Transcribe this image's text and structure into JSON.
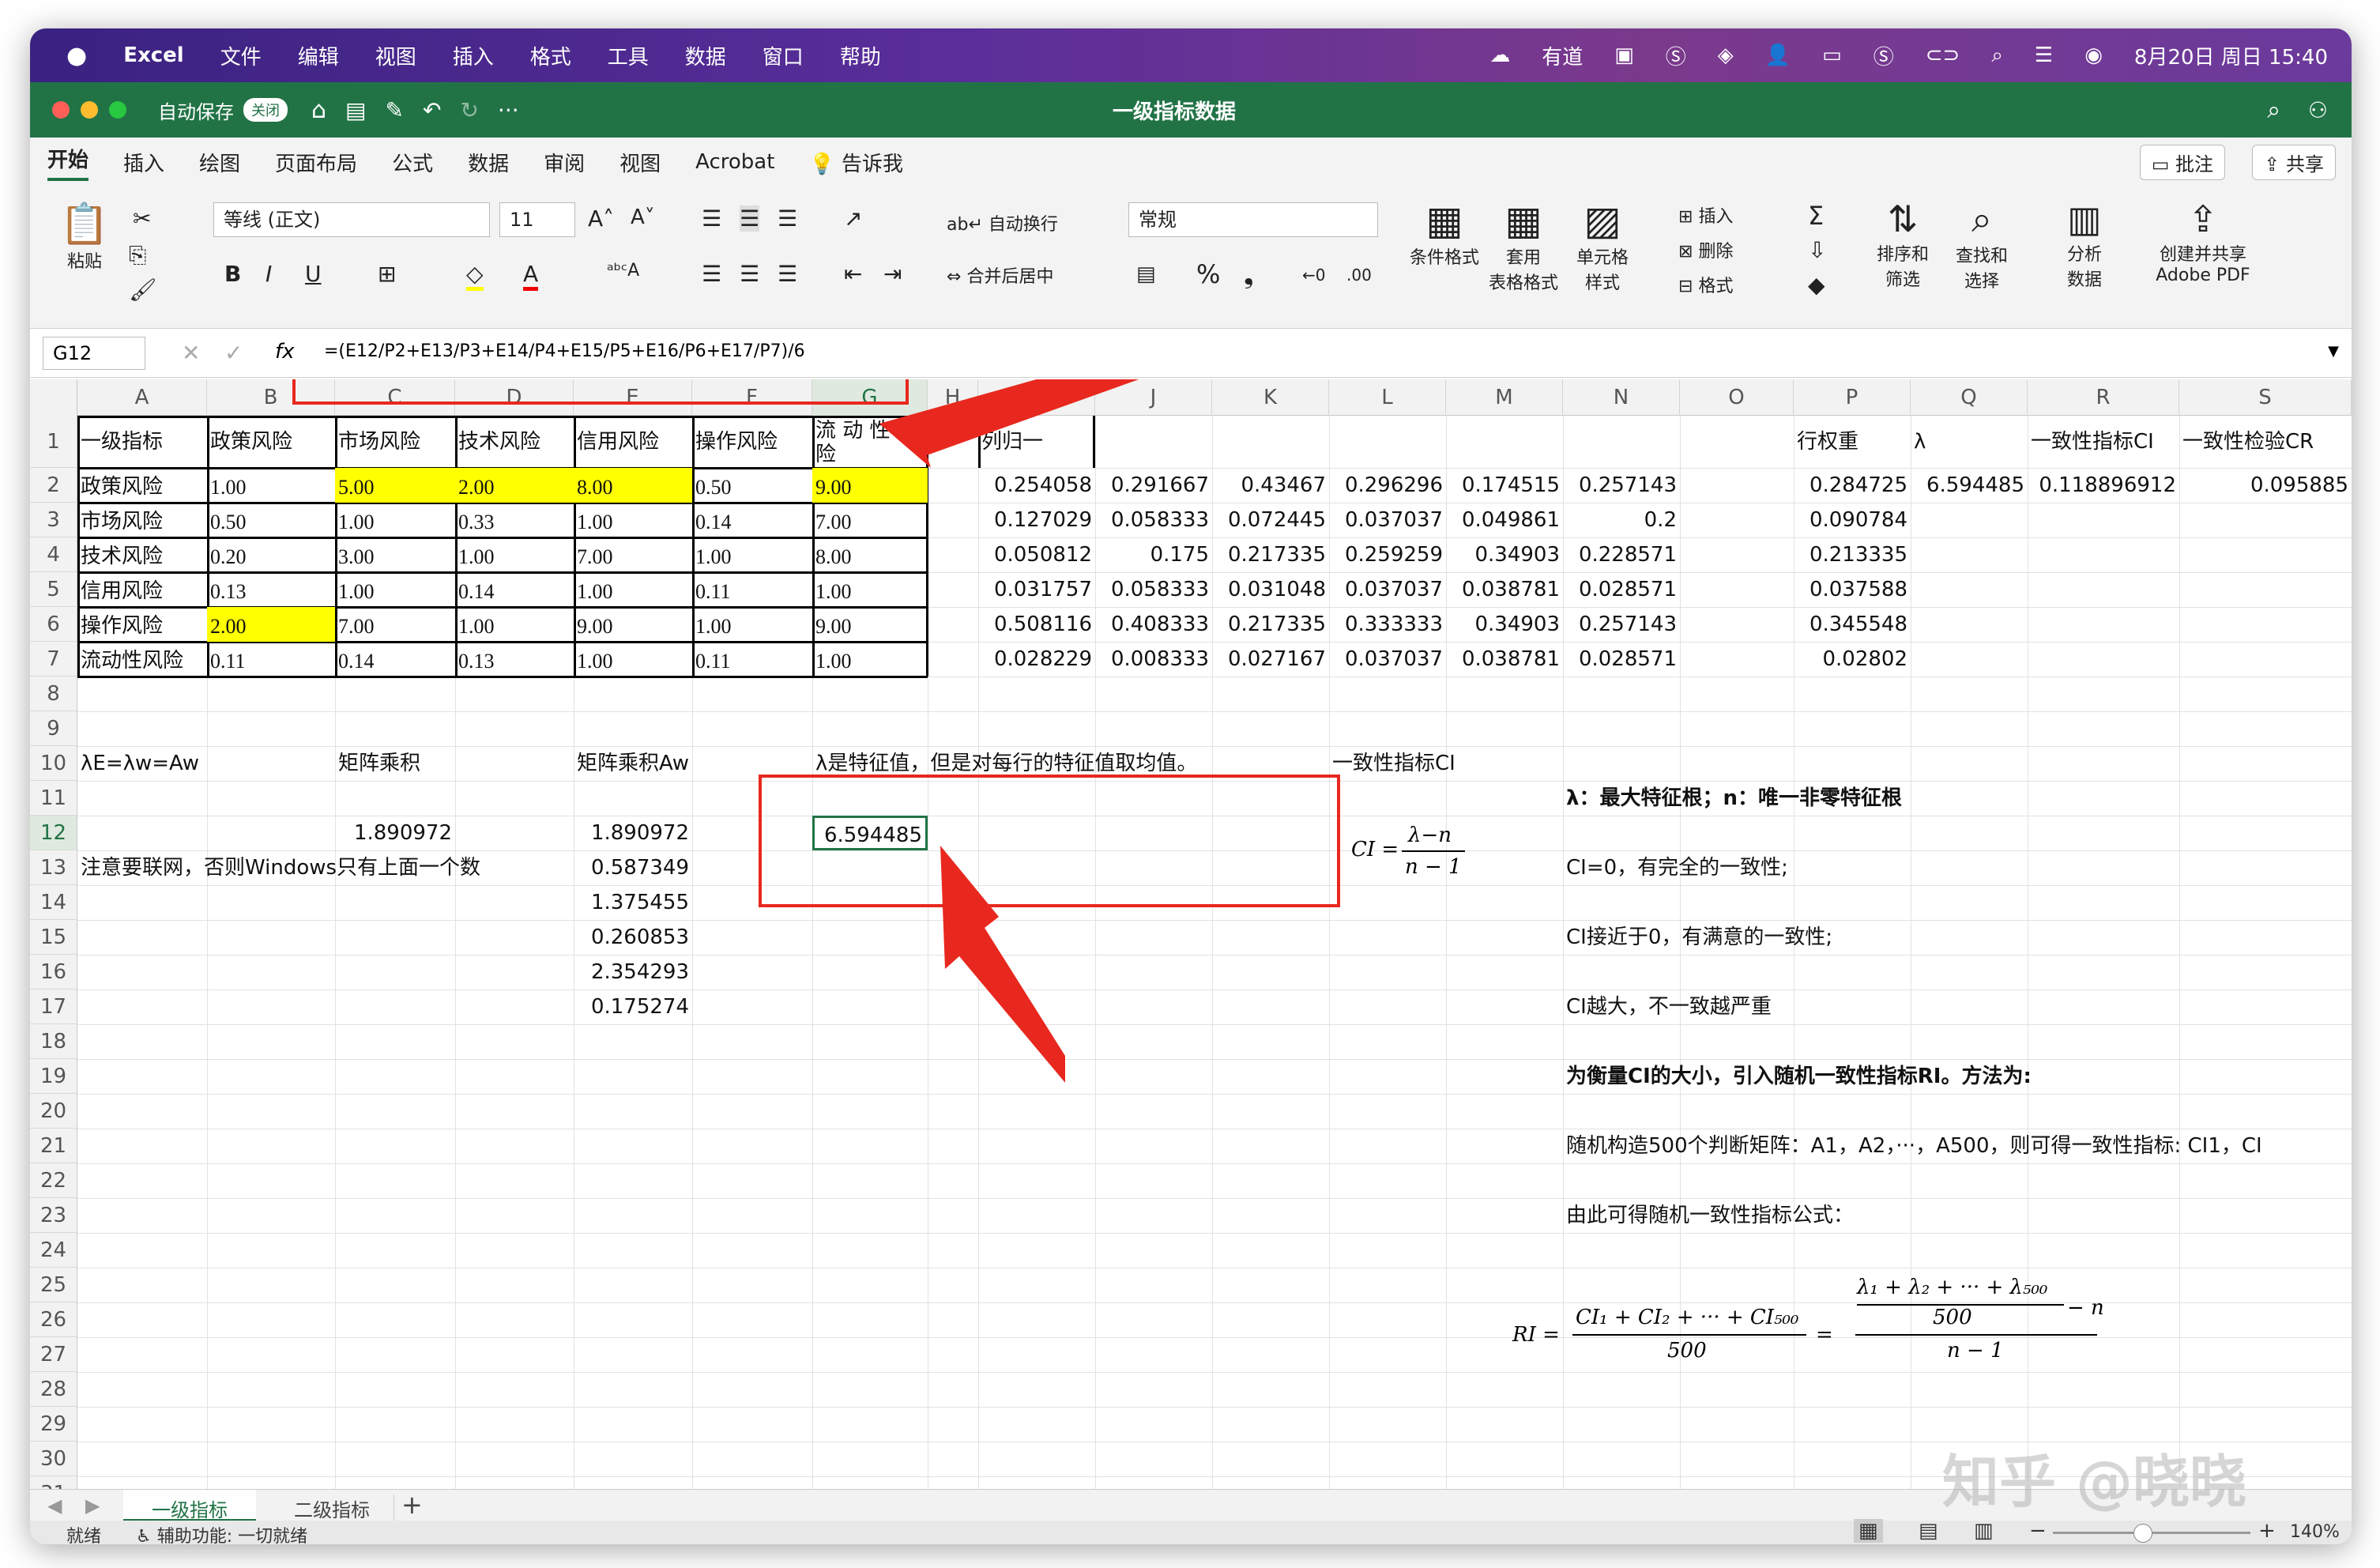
{
  "mac": {
    "app": "Excel",
    "menus": [
      "文件",
      "编辑",
      "视图",
      "插入",
      "格式",
      "工具",
      "数据",
      "窗口",
      "帮助"
    ],
    "youdao": "有道",
    "datetime": "8月20日 周日  15:40"
  },
  "window": {
    "autosave": "自动保存",
    "autosave_state": "关闭",
    "title": "一级指标数据"
  },
  "tabs": [
    "开始",
    "插入",
    "绘图",
    "页面布局",
    "公式",
    "数据",
    "审阅",
    "视图",
    "Acrobat",
    "告诉我"
  ],
  "tab_actions": {
    "comment": "批注",
    "share": "共享"
  },
  "ribbon": {
    "paste": "粘贴",
    "font": "等线 (正文)",
    "size": "11",
    "wrap": "自动换行",
    "merge": "合并后居中",
    "numfmt": "常规",
    "cond": "条件格式",
    "table1": "套用",
    "table2": "表格格式",
    "cellstyle1": "单元格",
    "cellstyle2": "样式",
    "insert": "插入",
    "delete": "删除",
    "format": "格式",
    "sort1": "排序和",
    "sort2": "筛选",
    "find1": "查找和",
    "find2": "选择",
    "analyze1": "分析",
    "analyze2": "数据",
    "pdf1": "创建并共享",
    "pdf2": "Adobe PDF"
  },
  "formula_bar": {
    "cell": "G12",
    "fx": "fx",
    "formula": "=(E12/P2+E13/P3+E14/P4+E15/P5+E16/P6+E17/P7)/6"
  },
  "columns": [
    "A",
    "B",
    "C",
    "D",
    "E",
    "F",
    "G",
    "H",
    "I",
    "J",
    "K",
    "L",
    "M",
    "N",
    "O",
    "P",
    "Q",
    "R",
    "S"
  ],
  "rows": [
    "1",
    "2",
    "3",
    "4",
    "5",
    "6",
    "7",
    "8",
    "9",
    "10",
    "11",
    "12",
    "13",
    "14",
    "15",
    "16",
    "17",
    "18",
    "19",
    "20",
    "21",
    "22",
    "23",
    "24",
    "25",
    "26",
    "27",
    "28",
    "29",
    "30",
    "31"
  ],
  "headers": [
    "一级指标",
    "政策风险",
    "市场风险",
    "技术风险",
    "信用风险",
    "操作风险",
    "流 动 性 风险"
  ],
  "matrix": [
    [
      "政策风险",
      "1.00",
      "5.00",
      "2.00",
      "8.00",
      "0.50",
      "9.00"
    ],
    [
      "市场风险",
      "0.50",
      "1.00",
      "0.33",
      "1.00",
      "0.14",
      "7.00"
    ],
    [
      "技术风险",
      "0.20",
      "3.00",
      "1.00",
      "7.00",
      "1.00",
      "8.00"
    ],
    [
      "信用风险",
      "0.13",
      "1.00",
      "0.14",
      "1.00",
      "0.11",
      "1.00"
    ],
    [
      "操作风险",
      "2.00",
      "7.00",
      "1.00",
      "9.00",
      "1.00",
      "9.00"
    ],
    [
      "流动性风险",
      "0.11",
      "0.14",
      "0.13",
      "1.00",
      "0.11",
      "1.00"
    ]
  ],
  "norm_label": "列归一",
  "norm": [
    [
      "0.254058",
      "0.291667",
      "0.43467",
      "0.296296",
      "0.174515",
      "0.257143"
    ],
    [
      "0.127029",
      "0.058333",
      "0.072445",
      "0.037037",
      "0.049861",
      "0.2"
    ],
    [
      "0.050812",
      "0.175",
      "0.217335",
      "0.259259",
      "0.34903",
      "0.228571"
    ],
    [
      "0.031757",
      "0.058333",
      "0.031048",
      "0.037037",
      "0.038781",
      "0.028571"
    ],
    [
      "0.508116",
      "0.408333",
      "0.217335",
      "0.333333",
      "0.34903",
      "0.257143"
    ],
    [
      "0.028229",
      "0.008333",
      "0.027167",
      "0.037037",
      "0.038781",
      "0.028571"
    ]
  ],
  "weights_label": "行权重",
  "weights": [
    "0.284725",
    "0.090784",
    "0.213335",
    "0.037588",
    "0.345548",
    "0.02802"
  ],
  "lambda_label": "λ",
  "lambda": "6.594485",
  "ci_label": "一致性指标CI",
  "ci": "0.118896912",
  "cr_label": "一致性检验CR",
  "cr": "0.095885",
  "a10": "λE=λw=Aw",
  "c10": "矩阵乘积",
  "e10": "矩阵乘积Aw",
  "g10": "λ是特征值，但是对每行的特征值取均值。",
  "l10": "一致性指标CI",
  "c12": "1.890972",
  "aw": [
    "1.890972",
    "0.587349",
    "1.375455",
    "0.260853",
    "2.354293",
    "0.175274"
  ],
  "g12": "6.594485",
  "a13": "注意要联网，否则Windows只有上面一个数",
  "notes": [
    "λ：最大特征根；n：唯一非零特征根",
    "CI=0，有完全的一致性;",
    "CI接近于0，有满意的一致性;",
    "CI越大，不一致越严重",
    "为衡量CI的大小，引入随机一致性指标RI。方法为:",
    "随机构造500个判断矩阵：A1，A2，···，A500，则可得一致性指标: CI1，CI",
    "由此可得随机一致性指标公式："
  ],
  "ci_formula": {
    "lhs": "CI =",
    "num": "λ−n",
    "den": "n − 1"
  },
  "ri_formula": {
    "lhs": "RI =",
    "n1": "CI₁ + CI₂ + ··· + CI₅₀₀",
    "d1": "500",
    "eq": "=",
    "n2top": "λ₁ + λ₂ + ··· + λ₅₀₀",
    "n2bot": "500",
    "minus": "− n",
    "d2": "n − 1"
  },
  "sheets": [
    "一级指标",
    "二级指标"
  ],
  "status": {
    "ready": "就绪",
    "access": "辅助功能: 一切就绪",
    "zoom": "140%"
  },
  "watermark": "知乎 @晓晓",
  "colors": {
    "excel_green": "#217346",
    "yellow": "#ffff00",
    "arrow_red": "#e8281e"
  }
}
